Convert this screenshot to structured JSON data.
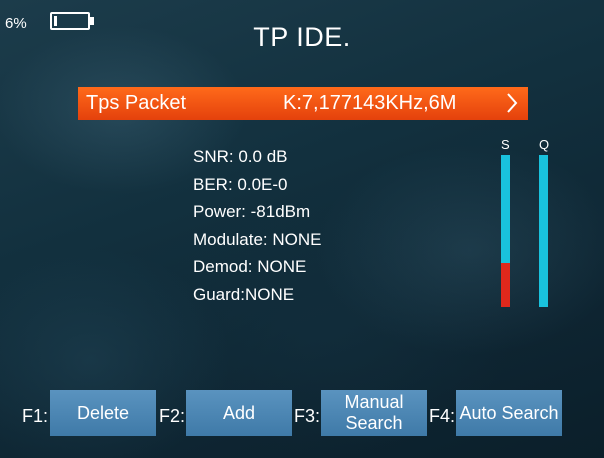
{
  "status": {
    "battery_percent_text": "6%",
    "battery_level": 0.06
  },
  "title": "TP IDE.",
  "tp": {
    "label": "Tps Packet",
    "value": "K:7,177143KHz,6M"
  },
  "info": {
    "snr": "SNR: 0.0 dB",
    "ber": "BER: 0.0E-0",
    "power": "Power: -81dBm",
    "modulate": "Modulate: NONE",
    "demod": "Demod: NONE",
    "guard": "Guard:NONE"
  },
  "meters": {
    "s_label": "S",
    "q_label": "Q",
    "s_level": 0.29,
    "q_level": 0.0,
    "bar_color": "#19c2dd",
    "fill_color": "#e0281c"
  },
  "footer": {
    "f1_key": "F1:",
    "f1_label": "Delete",
    "f2_key": "F2:",
    "f2_label": "Add",
    "f3_key": "F3:",
    "f3_label": "Manual\nSearch",
    "f4_key": "F4:",
    "f4_label": "Auto Search"
  },
  "colors": {
    "accent_orange": "#e4410c",
    "button_blue": "#4a84b0"
  }
}
